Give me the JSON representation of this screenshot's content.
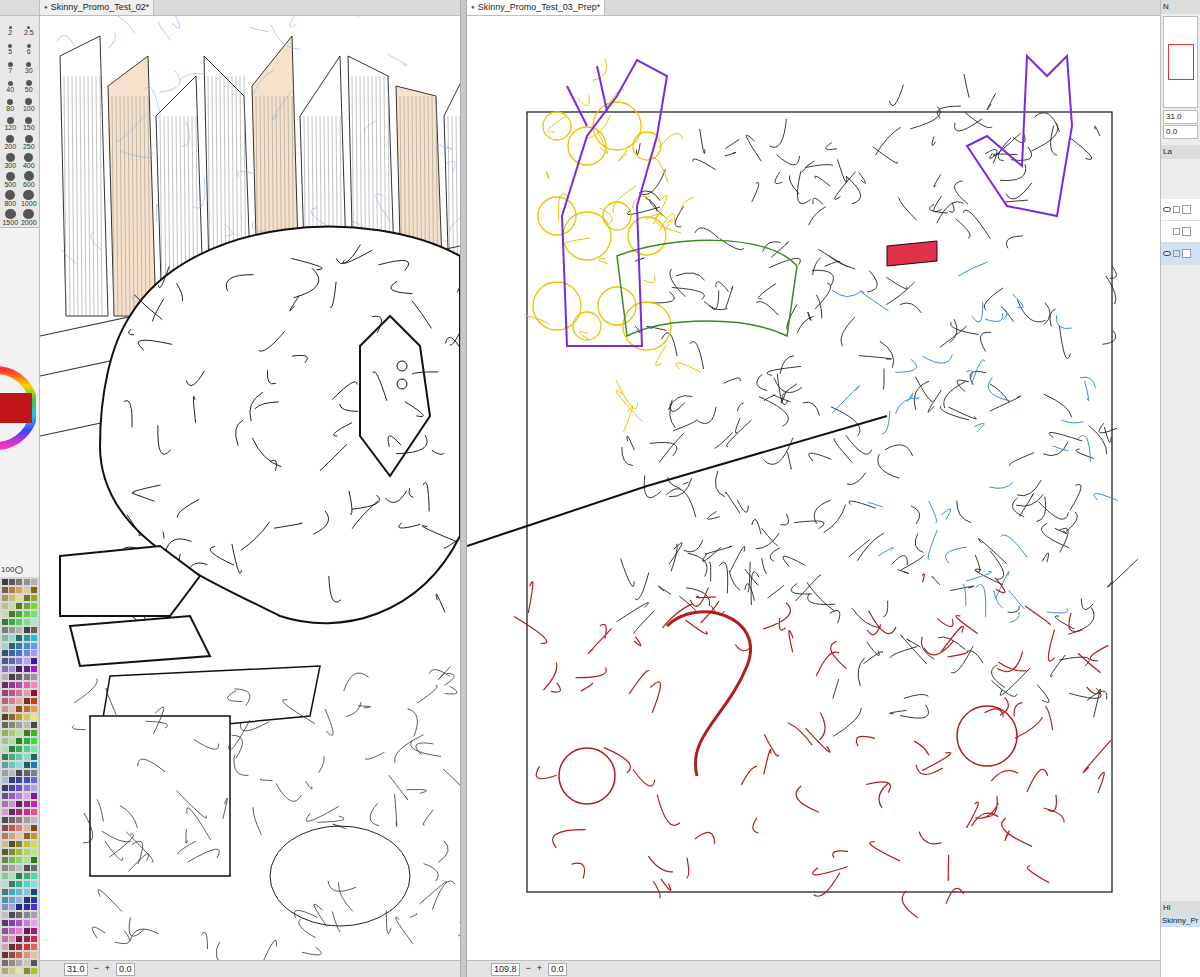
{
  "tool_palette": {
    "brush_sizes": [
      "2",
      "2.5",
      "5",
      "6",
      "7",
      "30",
      "40",
      "50",
      "80",
      "100",
      "120",
      "150",
      "200",
      "250",
      "300",
      "400",
      "500",
      "600",
      "800",
      "1000",
      "1500",
      "2000"
    ],
    "opacity": "100"
  },
  "documents": [
    {
      "title": "Skinny_Promo_Test_02*",
      "marker": "●",
      "selected": false,
      "zoom": "31.0",
      "rotation": "0.0",
      "minus": "−",
      "plus": "+"
    },
    {
      "title": "Skinny_Promo_Test_03_Prep*",
      "marker": "●",
      "selected": true,
      "zoom": "109.8",
      "rotation": "0.0",
      "minus": "−",
      "plus": "+"
    }
  ],
  "right_dock": {
    "navigator": {
      "tab": "N",
      "zoom": "31.0",
      "rotation": "0.0"
    },
    "layer": {
      "tab": "La",
      "layers": [
        {
          "visible": true,
          "selected": false
        },
        {
          "visible": false,
          "selected": false
        },
        {
          "visible": true,
          "selected": true
        }
      ]
    },
    "history": {
      "tab": "Hi",
      "items": [
        {
          "label": "Skinny_Pr",
          "selected": true
        }
      ]
    }
  }
}
